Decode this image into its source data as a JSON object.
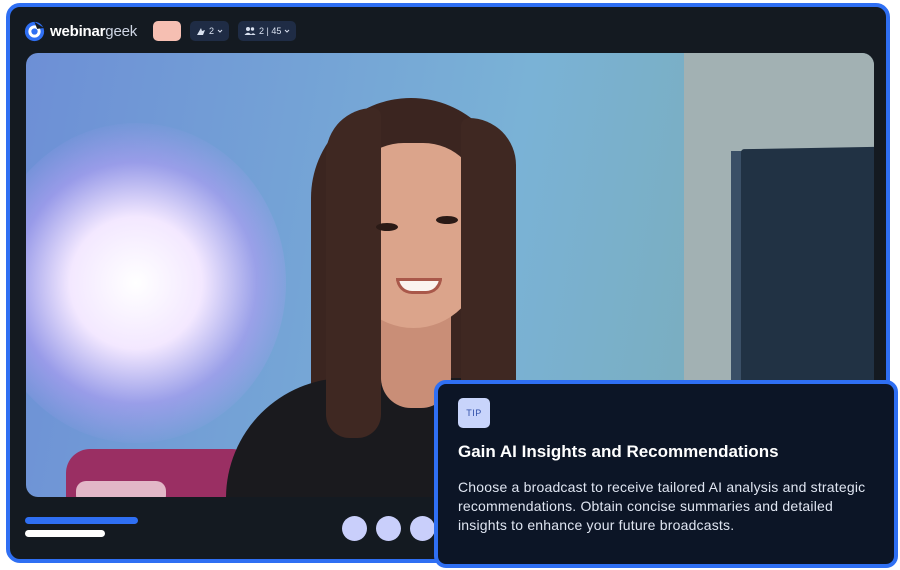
{
  "header": {
    "brand_bold": "webinar",
    "brand_light": "geek",
    "attendee_badge_count": "2",
    "participants_badge_count": "2 | 45"
  },
  "controls": {
    "progress_fraction": 0.6
  },
  "tip": {
    "badge": "TIP",
    "title": "Gain AI Insights and Recommendations",
    "body": "Choose a broadcast to receive tailored AI analysis and strategic recommendations. Obtain concise summaries and detailed insights to enhance your future broadcasts."
  },
  "colors": {
    "frame_border": "#2f6ff3",
    "frame_bg": "#141a21",
    "rec_pill": "#f6bfb2",
    "control_button": "#c9cffb",
    "tip_badge_bg": "#c8d4fb"
  },
  "icons": {
    "logo": "webinargeek-logo-icon",
    "presenter": "presenter-icon",
    "participants": "participants-icon",
    "dropdown": "chevron-down-icon"
  }
}
